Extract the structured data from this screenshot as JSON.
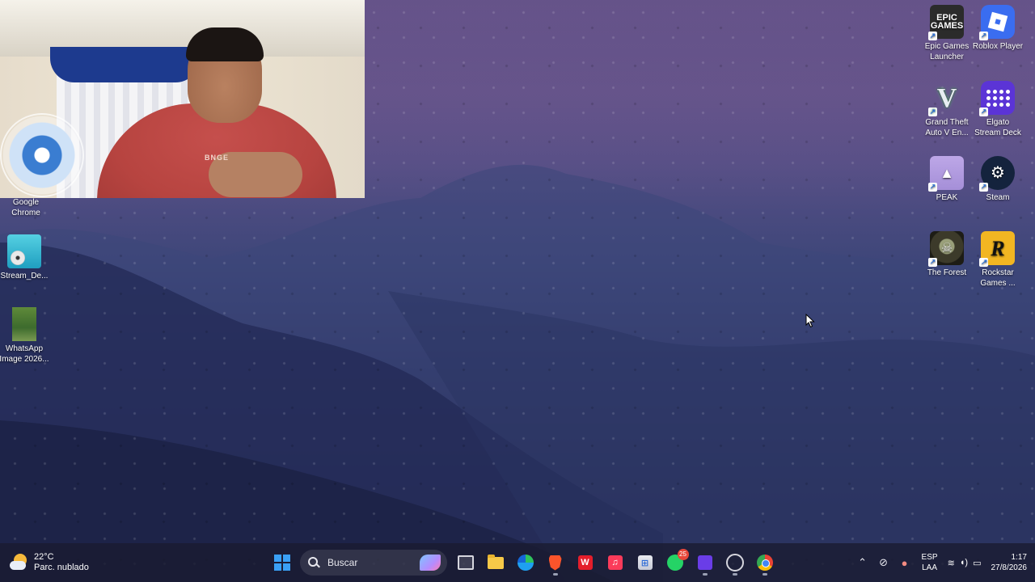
{
  "desktop": {
    "icons_left": [
      {
        "label": "Google\nChrome"
      },
      {
        "label": "Stream_De..."
      },
      {
        "label": "WhatsApp\nImage 2026..."
      }
    ],
    "icons_right": [
      {
        "label": "Epic Games\nLauncher",
        "icon": "epic-games-icon",
        "glyph": "EPIC\nGAMES"
      },
      {
        "label": "Roblox Player",
        "icon": "roblox-icon"
      },
      {
        "label": "Grand Theft\nAuto V En...",
        "icon": "gta-v-icon",
        "glyph": "V"
      },
      {
        "label": "Elgato\nStream Deck",
        "icon": "elgato-stream-deck-icon"
      },
      {
        "label": "PEAK",
        "icon": "peak-icon",
        "glyph": "▲"
      },
      {
        "label": "Steam",
        "icon": "steam-icon",
        "glyph": "⚙"
      },
      {
        "label": "The Forest",
        "icon": "the-forest-icon",
        "glyph": "☠"
      },
      {
        "label": "Rockstar\nGames ...",
        "icon": "rockstar-games-icon",
        "glyph": "R"
      }
    ]
  },
  "webcam": {
    "shirt_text": "BNGE"
  },
  "taskbar": {
    "weather": {
      "temperature": "22°C",
      "condition": "Parc. nublado"
    },
    "search_placeholder": "Buscar",
    "apps": [
      {
        "name": "task-view"
      },
      {
        "name": "file-explorer"
      },
      {
        "name": "edge"
      },
      {
        "name": "brave"
      },
      {
        "name": "wps-office",
        "glyph": "W"
      },
      {
        "name": "apple-music",
        "glyph": "♫"
      },
      {
        "name": "microsoft-store",
        "glyph": "⊞"
      },
      {
        "name": "whatsapp",
        "badge": "25"
      },
      {
        "name": "elgato-stream-deck"
      },
      {
        "name": "app-circle"
      },
      {
        "name": "chrome"
      }
    ],
    "tray": {
      "language_line1": "ESP",
      "language_line2": "LAA",
      "time": "1:17",
      "date": "27/8/2026"
    }
  }
}
